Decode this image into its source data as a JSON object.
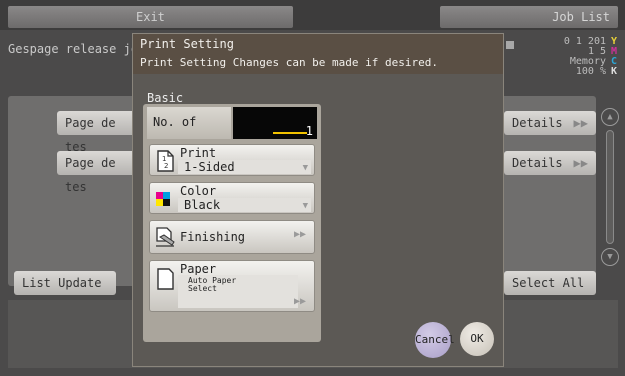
{
  "topbar": {
    "exit_label": "Exit",
    "job_list_label": "Job List"
  },
  "background": {
    "title": "Gespage release job",
    "status": {
      "line1": "0 1 201",
      "line2": "1 5",
      "memory": "Memory",
      "percent": "100 %",
      "cmyk": [
        "Y",
        "M",
        "C",
        "K"
      ]
    },
    "rows": [
      {
        "label": "Page de tes",
        "details": "Details"
      },
      {
        "label": "Page de tes",
        "details": "Details"
      }
    ],
    "list_update_label": "List Update",
    "select_all_label": "Select All"
  },
  "dialog": {
    "title": "Print Setting",
    "message": "Print Setting Changes can be made if desired.",
    "basic_label": "Basic",
    "sets": {
      "label": "No. of Sets",
      "value": "1"
    },
    "print": {
      "label": "Print",
      "value": "1-Sided"
    },
    "color": {
      "label": "Color",
      "value": "Black"
    },
    "finishing": {
      "label": "Finishing"
    },
    "paper": {
      "label": "Paper",
      "value_line1": "Auto Paper",
      "value_line2": "Select"
    },
    "cancel_label": "Cancel",
    "ok_label": "OK"
  },
  "colors": {
    "dialog_header": "#5a4f44",
    "field_cursor": "#f2c200"
  }
}
